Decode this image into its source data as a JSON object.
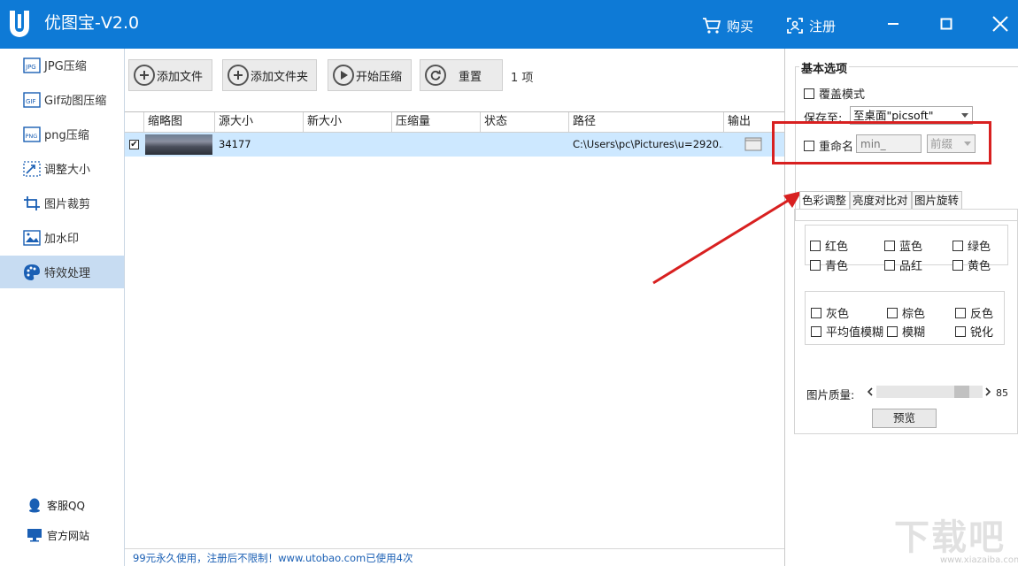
{
  "app": {
    "title": "优图宝-V2.0",
    "brand_color": "#0e7ad6"
  },
  "titlebar": {
    "buy_label": "购买",
    "register_label": "注册"
  },
  "sidebar": {
    "items": [
      {
        "label": "JPG压缩",
        "icon": "jpg-icon"
      },
      {
        "label": "Gif动图压缩",
        "icon": "gif-icon"
      },
      {
        "label": "png压缩",
        "icon": "png-icon"
      },
      {
        "label": "调整大小",
        "icon": "resize-icon"
      },
      {
        "label": "图片裁剪",
        "icon": "crop-icon"
      },
      {
        "label": "加水印",
        "icon": "watermark-icon"
      },
      {
        "label": "特效处理",
        "icon": "palette-icon",
        "active": true
      }
    ],
    "bottom": {
      "qq_label": "客服QQ",
      "website_label": "官方网站"
    }
  },
  "toolbar": {
    "add_file": "添加文件",
    "add_folder": "添加文件夹",
    "start": "开始压缩",
    "reset": "重置",
    "count": "1 项"
  },
  "table": {
    "headers": [
      "缩略图",
      "源大小",
      "新大小",
      "压缩量",
      "状态",
      "路径",
      "输出"
    ],
    "rows": [
      {
        "checked": true,
        "source_size": "34177",
        "new_size": "",
        "ratio": "",
        "status": "",
        "path": "C:\\Users\\pc\\Pictures\\u=2920..."
      }
    ]
  },
  "status": {
    "text": "99元永久使用，注册后不限制！www.utobao.com已使用4次"
  },
  "options": {
    "title": "基本选项",
    "overwrite_label": "覆盖模式",
    "save_to_label": "保存至:",
    "save_to_value": "至桌面\"picsoft\"",
    "rename_label": "重命名",
    "rename_placeholder": "min_",
    "rename_position": "前缀"
  },
  "tabs": {
    "color": "色彩调整",
    "brightness": "亮度对比对",
    "rotate": "图片旋转"
  },
  "colors": {
    "group1": [
      "红色",
      "蓝色",
      "绿色",
      "青色",
      "品红",
      "黄色"
    ],
    "group2": [
      "灰色",
      "棕色",
      "反色",
      "平均值模糊",
      "模糊",
      "锐化"
    ]
  },
  "quality": {
    "label": "图片质量:",
    "value": "85",
    "level": 85
  },
  "preview_label": "预览",
  "watermark": {
    "text": "下载吧",
    "url": "www.xiazaiba.com"
  }
}
